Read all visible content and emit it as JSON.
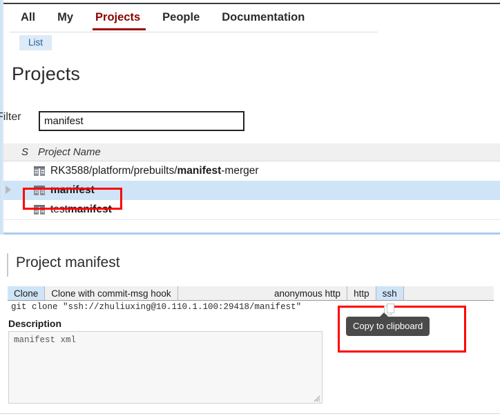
{
  "nav": {
    "items": [
      {
        "label": "All",
        "active": false
      },
      {
        "label": "My",
        "active": false
      },
      {
        "label": "Projects",
        "active": true
      },
      {
        "label": "People",
        "active": false
      },
      {
        "label": "Documentation",
        "active": false
      }
    ],
    "active_color": "#8b0000",
    "underline_color": "#9c0000"
  },
  "subnav": {
    "items": [
      {
        "label": "List",
        "active": true
      }
    ],
    "active_bg": "#ddeaf7",
    "active_fg": "#1f5c99"
  },
  "page": {
    "title": "Projects"
  },
  "filter": {
    "label": "Filter",
    "value": "manifest",
    "placeholder": ""
  },
  "project_list": {
    "columns": [
      {
        "key": "s",
        "label": "S"
      },
      {
        "key": "name",
        "label": "Project Name"
      }
    ],
    "rows": [
      {
        "icon": "project-icon",
        "prefix": "RK3588/platform/prebuilts/",
        "match": "manifest",
        "suffix": "-merger",
        "selected": false,
        "expanded": false
      },
      {
        "icon": "project-icon",
        "prefix": "",
        "match": "manifest",
        "suffix": "",
        "selected": true,
        "expanded": true
      },
      {
        "icon": "project-icon",
        "prefix": "test",
        "match": "manifest",
        "suffix": "",
        "selected": false,
        "expanded": false
      }
    ],
    "selected_bg": "#cfe4f7",
    "header_bg": "#f0f0f0"
  },
  "detail": {
    "title": "Project manifest",
    "clone_tabs": [
      {
        "label": "Clone",
        "selected": true
      },
      {
        "label": "Clone with commit-msg hook",
        "selected": false
      }
    ],
    "scheme_tabs": [
      {
        "label": "anonymous http",
        "selected": false
      },
      {
        "label": "http",
        "selected": false
      },
      {
        "label": "ssh",
        "selected": true
      }
    ],
    "clone_command": "git clone \"ssh://zhuliuxing@10.110.1.100:29418/manifest\"",
    "description_label": "Description",
    "description_value": "manifest xml"
  },
  "tooltip": {
    "text": "Copy to clipboard",
    "bg": "#4a4a4a",
    "fg": "#ffffff",
    "icon": "clipboard-icon"
  },
  "annotations": {
    "color": "#ff0000",
    "boxes": [
      {
        "name": "selected-project-highlight"
      },
      {
        "name": "copy-to-clipboard-highlight"
      }
    ]
  }
}
